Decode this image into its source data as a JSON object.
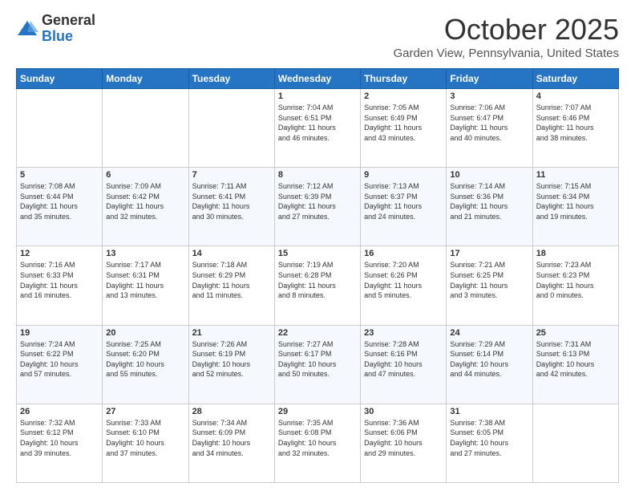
{
  "logo": {
    "general": "General",
    "blue": "Blue"
  },
  "header": {
    "month": "October 2025",
    "location": "Garden View, Pennsylvania, United States"
  },
  "days_of_week": [
    "Sunday",
    "Monday",
    "Tuesday",
    "Wednesday",
    "Thursday",
    "Friday",
    "Saturday"
  ],
  "weeks": [
    [
      {
        "day": "",
        "info": ""
      },
      {
        "day": "",
        "info": ""
      },
      {
        "day": "",
        "info": ""
      },
      {
        "day": "1",
        "info": "Sunrise: 7:04 AM\nSunset: 6:51 PM\nDaylight: 11 hours\nand 46 minutes."
      },
      {
        "day": "2",
        "info": "Sunrise: 7:05 AM\nSunset: 6:49 PM\nDaylight: 11 hours\nand 43 minutes."
      },
      {
        "day": "3",
        "info": "Sunrise: 7:06 AM\nSunset: 6:47 PM\nDaylight: 11 hours\nand 40 minutes."
      },
      {
        "day": "4",
        "info": "Sunrise: 7:07 AM\nSunset: 6:46 PM\nDaylight: 11 hours\nand 38 minutes."
      }
    ],
    [
      {
        "day": "5",
        "info": "Sunrise: 7:08 AM\nSunset: 6:44 PM\nDaylight: 11 hours\nand 35 minutes."
      },
      {
        "day": "6",
        "info": "Sunrise: 7:09 AM\nSunset: 6:42 PM\nDaylight: 11 hours\nand 32 minutes."
      },
      {
        "day": "7",
        "info": "Sunrise: 7:11 AM\nSunset: 6:41 PM\nDaylight: 11 hours\nand 30 minutes."
      },
      {
        "day": "8",
        "info": "Sunrise: 7:12 AM\nSunset: 6:39 PM\nDaylight: 11 hours\nand 27 minutes."
      },
      {
        "day": "9",
        "info": "Sunrise: 7:13 AM\nSunset: 6:37 PM\nDaylight: 11 hours\nand 24 minutes."
      },
      {
        "day": "10",
        "info": "Sunrise: 7:14 AM\nSunset: 6:36 PM\nDaylight: 11 hours\nand 21 minutes."
      },
      {
        "day": "11",
        "info": "Sunrise: 7:15 AM\nSunset: 6:34 PM\nDaylight: 11 hours\nand 19 minutes."
      }
    ],
    [
      {
        "day": "12",
        "info": "Sunrise: 7:16 AM\nSunset: 6:33 PM\nDaylight: 11 hours\nand 16 minutes."
      },
      {
        "day": "13",
        "info": "Sunrise: 7:17 AM\nSunset: 6:31 PM\nDaylight: 11 hours\nand 13 minutes."
      },
      {
        "day": "14",
        "info": "Sunrise: 7:18 AM\nSunset: 6:29 PM\nDaylight: 11 hours\nand 11 minutes."
      },
      {
        "day": "15",
        "info": "Sunrise: 7:19 AM\nSunset: 6:28 PM\nDaylight: 11 hours\nand 8 minutes."
      },
      {
        "day": "16",
        "info": "Sunrise: 7:20 AM\nSunset: 6:26 PM\nDaylight: 11 hours\nand 5 minutes."
      },
      {
        "day": "17",
        "info": "Sunrise: 7:21 AM\nSunset: 6:25 PM\nDaylight: 11 hours\nand 3 minutes."
      },
      {
        "day": "18",
        "info": "Sunrise: 7:23 AM\nSunset: 6:23 PM\nDaylight: 11 hours\nand 0 minutes."
      }
    ],
    [
      {
        "day": "19",
        "info": "Sunrise: 7:24 AM\nSunset: 6:22 PM\nDaylight: 10 hours\nand 57 minutes."
      },
      {
        "day": "20",
        "info": "Sunrise: 7:25 AM\nSunset: 6:20 PM\nDaylight: 10 hours\nand 55 minutes."
      },
      {
        "day": "21",
        "info": "Sunrise: 7:26 AM\nSunset: 6:19 PM\nDaylight: 10 hours\nand 52 minutes."
      },
      {
        "day": "22",
        "info": "Sunrise: 7:27 AM\nSunset: 6:17 PM\nDaylight: 10 hours\nand 50 minutes."
      },
      {
        "day": "23",
        "info": "Sunrise: 7:28 AM\nSunset: 6:16 PM\nDaylight: 10 hours\nand 47 minutes."
      },
      {
        "day": "24",
        "info": "Sunrise: 7:29 AM\nSunset: 6:14 PM\nDaylight: 10 hours\nand 44 minutes."
      },
      {
        "day": "25",
        "info": "Sunrise: 7:31 AM\nSunset: 6:13 PM\nDaylight: 10 hours\nand 42 minutes."
      }
    ],
    [
      {
        "day": "26",
        "info": "Sunrise: 7:32 AM\nSunset: 6:12 PM\nDaylight: 10 hours\nand 39 minutes."
      },
      {
        "day": "27",
        "info": "Sunrise: 7:33 AM\nSunset: 6:10 PM\nDaylight: 10 hours\nand 37 minutes."
      },
      {
        "day": "28",
        "info": "Sunrise: 7:34 AM\nSunset: 6:09 PM\nDaylight: 10 hours\nand 34 minutes."
      },
      {
        "day": "29",
        "info": "Sunrise: 7:35 AM\nSunset: 6:08 PM\nDaylight: 10 hours\nand 32 minutes."
      },
      {
        "day": "30",
        "info": "Sunrise: 7:36 AM\nSunset: 6:06 PM\nDaylight: 10 hours\nand 29 minutes."
      },
      {
        "day": "31",
        "info": "Sunrise: 7:38 AM\nSunset: 6:05 PM\nDaylight: 10 hours\nand 27 minutes."
      },
      {
        "day": "",
        "info": ""
      }
    ]
  ]
}
